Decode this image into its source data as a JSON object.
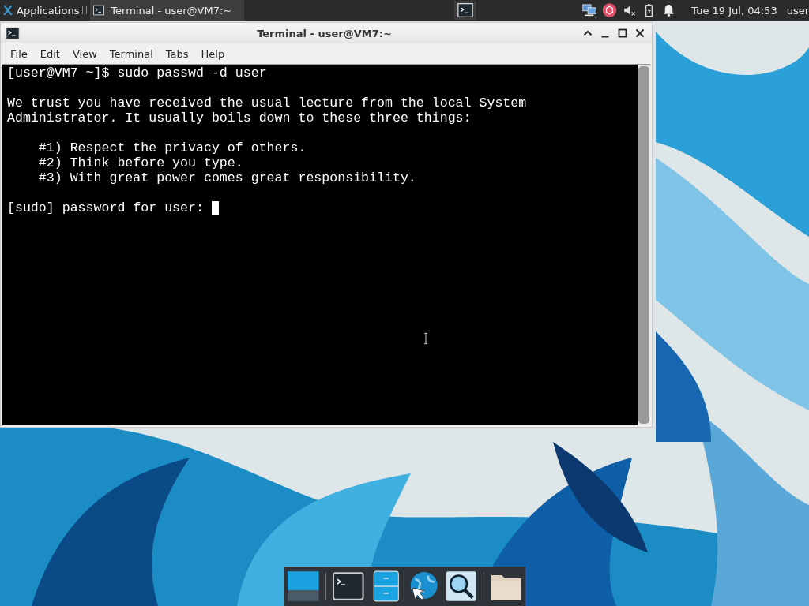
{
  "top_panel": {
    "applications_label": "Applications",
    "taskbar_items": [
      {
        "title": "Terminal - user@VM7:~",
        "selected": true
      }
    ],
    "clock": "Tue 19 Jul, 04:53",
    "user": "user"
  },
  "window": {
    "title": "Terminal - user@VM7:~",
    "menu": [
      "File",
      "Edit",
      "View",
      "Terminal",
      "Tabs",
      "Help"
    ],
    "terminal_blocks": [
      {
        "lines": [
          "[user@VM7 ~]$ sudo passwd -d user"
        ]
      },
      {
        "lines": [
          "We trust you have received the usual lecture from the local System",
          "Administrator. It usually boils down to these three things:"
        ]
      },
      {
        "lines": [
          "    #1) Respect the privacy of others.",
          "    #2) Think before you type.",
          "    #3) With great power comes great responsibility."
        ]
      },
      {
        "lines": [
          "[sudo] password for user:"
        ]
      }
    ]
  },
  "dock": {
    "items": [
      {
        "kind": "desktop"
      },
      {
        "kind": "terminal"
      },
      {
        "kind": "files"
      },
      {
        "kind": "browser"
      },
      {
        "kind": "search"
      },
      {
        "kind": "separator"
      },
      {
        "kind": "folder"
      }
    ]
  }
}
